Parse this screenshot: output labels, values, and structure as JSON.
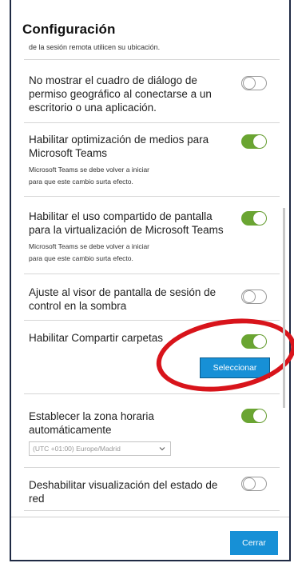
{
  "dialog": {
    "title": "Configuración",
    "truncated_text": "de la sesión remota utilicen su ubicación."
  },
  "settings": [
    {
      "label": "No mostrar el cuadro de diálogo de permiso geográfico al conectarse a un escritorio o una aplicación.",
      "note": "",
      "enabled": false
    },
    {
      "label": "Habilitar optimización de medios para Microsoft Teams",
      "note_line1": "Microsoft Teams se debe volver a iniciar",
      "note_line2": "para que este cambio surta efecto.",
      "enabled": true
    },
    {
      "label": "Habilitar el uso compartido de pantalla para la virtualización de Microsoft Teams",
      "note_line1": "Microsoft Teams se debe volver a iniciar",
      "note_line2": "para que este cambio surta efecto.",
      "enabled": true
    },
    {
      "label": "Ajuste al visor de pantalla de sesión de control en la sombra",
      "note": "",
      "enabled": false
    },
    {
      "label": "Habilitar Compartir carpetas",
      "note": "",
      "enabled": true,
      "button_label": "Seleccionar"
    },
    {
      "label": "Establecer la zona horaria automáticamente",
      "enabled": true,
      "timezone_value": "(UTC +01:00) Europe/Madrid"
    },
    {
      "label": "Deshabilitar visualización del estado de red",
      "note": "",
      "enabled": false
    }
  ],
  "footer": {
    "close_label": "Cerrar"
  },
  "colors": {
    "toggle_on": "#6aa532",
    "primary_button": "#1790d6",
    "highlight_ellipse": "#d8141b"
  },
  "icons": {
    "dropdown": "chevron-down-icon"
  }
}
